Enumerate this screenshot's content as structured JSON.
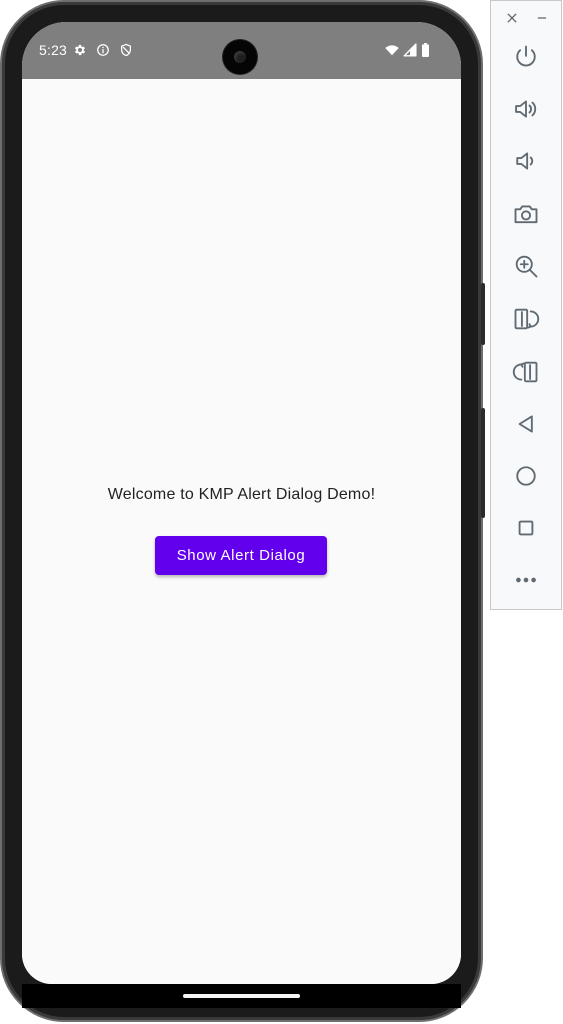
{
  "status_bar": {
    "time": "5:23",
    "left_icons": [
      "settings-gear-icon",
      "info-icon",
      "shield-icon"
    ],
    "right_icons": [
      "wifi-icon",
      "cellular-signal-icon",
      "battery-icon"
    ]
  },
  "app": {
    "welcome_text": "Welcome to KMP Alert Dialog Demo!",
    "button_label": "Show Alert Dialog"
  },
  "emulator_toolbar": {
    "window_controls": [
      "close-icon",
      "minimize-icon"
    ],
    "buttons": [
      "power-icon",
      "volume-up-icon",
      "volume-down-icon",
      "camera-icon",
      "zoom-icon",
      "rotate-left-icon",
      "rotate-right-icon",
      "back-icon",
      "home-icon",
      "overview-icon",
      "more-icon"
    ]
  },
  "colors": {
    "status_bar": "#7f7f7f",
    "screen_background": "#fafafa",
    "button_primary": "#6200ee",
    "button_text": "#ffffff",
    "toolbar_background": "#f8f9fa",
    "toolbar_icon": "#5f6a72",
    "device_frame": "#1b1b1b"
  }
}
